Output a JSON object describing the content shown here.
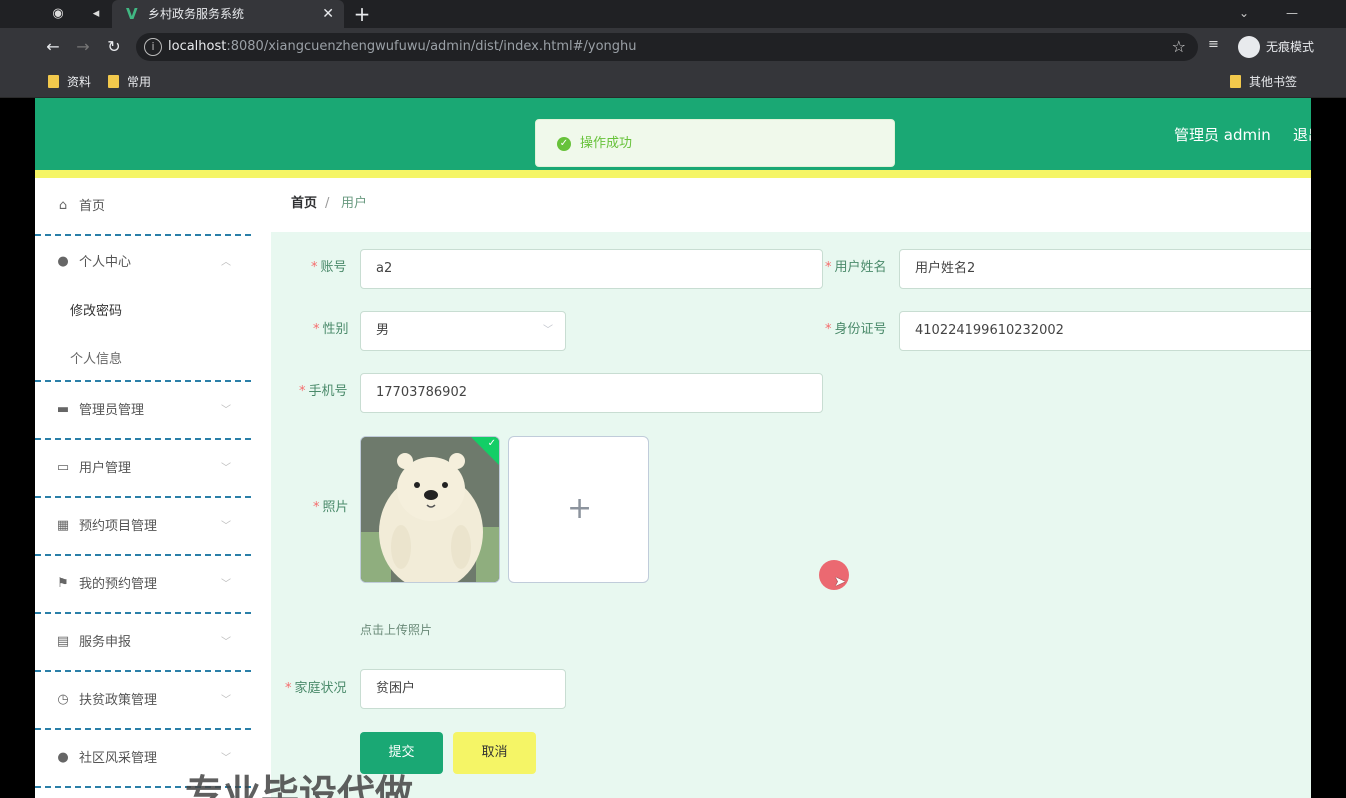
{
  "browser": {
    "tab_title": "乡村政务服务系统",
    "url_host": "localhost",
    "url_rest": ":8080/xiangcuenzhengwufuwu/admin/dist/index.html#/yonghu",
    "incognito_label": "无痕模式",
    "bookmarks": [
      "资料",
      "常用"
    ],
    "other_bookmarks": "其他书签"
  },
  "header": {
    "user": "管理员 admin",
    "logout": "退出",
    "toast": "操作成功"
  },
  "sidebar": {
    "items": [
      {
        "label": "首页",
        "icon": "home-icon"
      },
      {
        "label": "个人中心",
        "icon": "user-icon"
      },
      {
        "label": "修改密码"
      },
      {
        "label": "个人信息"
      },
      {
        "label": "管理员管理",
        "icon": "briefcase-icon"
      },
      {
        "label": "用户管理",
        "icon": "chat-icon"
      },
      {
        "label": "预约项目管理",
        "icon": "grid-icon"
      },
      {
        "label": "我的预约管理",
        "icon": "flag-icon"
      },
      {
        "label": "服务申报",
        "icon": "card-icon"
      },
      {
        "label": "扶贫政策管理",
        "icon": "clock-icon"
      },
      {
        "label": "社区风采管理",
        "icon": "user-icon"
      }
    ]
  },
  "breadcrumb": {
    "home": "首页",
    "sep": "/",
    "current": "用户"
  },
  "form": {
    "account_label": "账号",
    "account_value": "a2",
    "name_label": "用户姓名",
    "name_value": "用户姓名2",
    "gender_label": "性别",
    "gender_value": "男",
    "id_label": "身份证号",
    "id_value": "410224199610232002",
    "phone_label": "手机号",
    "phone_value": "17703786902",
    "photo_label": "照片",
    "upload_plus": "+",
    "upload_tip": "点击上传照片",
    "family_label": "家庭状况",
    "family_value": "贫困户",
    "submit": "提交",
    "cancel": "取消"
  },
  "watermark": "专业毕设代做"
}
